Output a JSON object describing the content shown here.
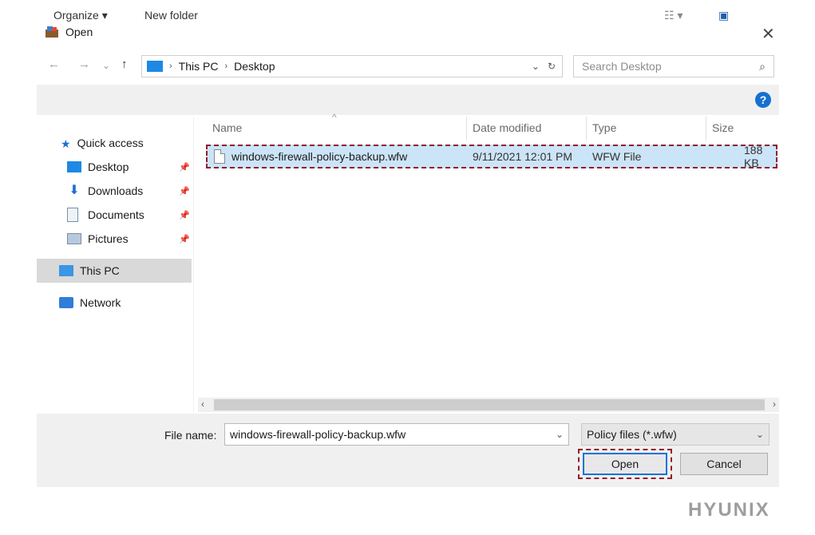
{
  "dialog": {
    "title": "Open",
    "close_glyph": "✕"
  },
  "nav": {
    "back": "←",
    "forward": "→",
    "recent": "⌄",
    "up": "↑",
    "breadcrumb": [
      "This PC",
      "Desktop"
    ],
    "search_placeholder": "Search Desktop"
  },
  "toolbar": {
    "organize_label": "Organize ▾",
    "new_folder_label": "New folder",
    "help_label": "?"
  },
  "sidebar": {
    "items": [
      {
        "label": "Quick access",
        "icon": "star-icon"
      },
      {
        "label": "Desktop",
        "icon": "desktop-folder-icon"
      },
      {
        "label": "Downloads",
        "icon": "download-icon"
      },
      {
        "label": "Documents",
        "icon": "document-icon"
      },
      {
        "label": "Pictures",
        "icon": "picture-icon"
      },
      {
        "label": "This PC",
        "icon": "computer-icon"
      },
      {
        "label": "Network",
        "icon": "network-icon"
      }
    ]
  },
  "filelist": {
    "columns": [
      "Name",
      "Date modified",
      "Type",
      "Size"
    ],
    "rows": [
      {
        "name": "windows-firewall-policy-backup.wfw",
        "date": "9/11/2021 12:01 PM",
        "type": "WFW File",
        "size": "188 KB"
      }
    ]
  },
  "footer": {
    "filename_label": "File name:",
    "filename_value": "windows-firewall-policy-backup.wfw",
    "filter_value": "Policy files (*.wfw)",
    "open_label": "Open",
    "cancel_label": "Cancel"
  },
  "watermark": "HYUNIX",
  "colors": {
    "accent": "#0a74d8",
    "selection": "#cce4f7",
    "highlight_dash": "#8f1f2d",
    "panel": "#f0f0f0"
  }
}
